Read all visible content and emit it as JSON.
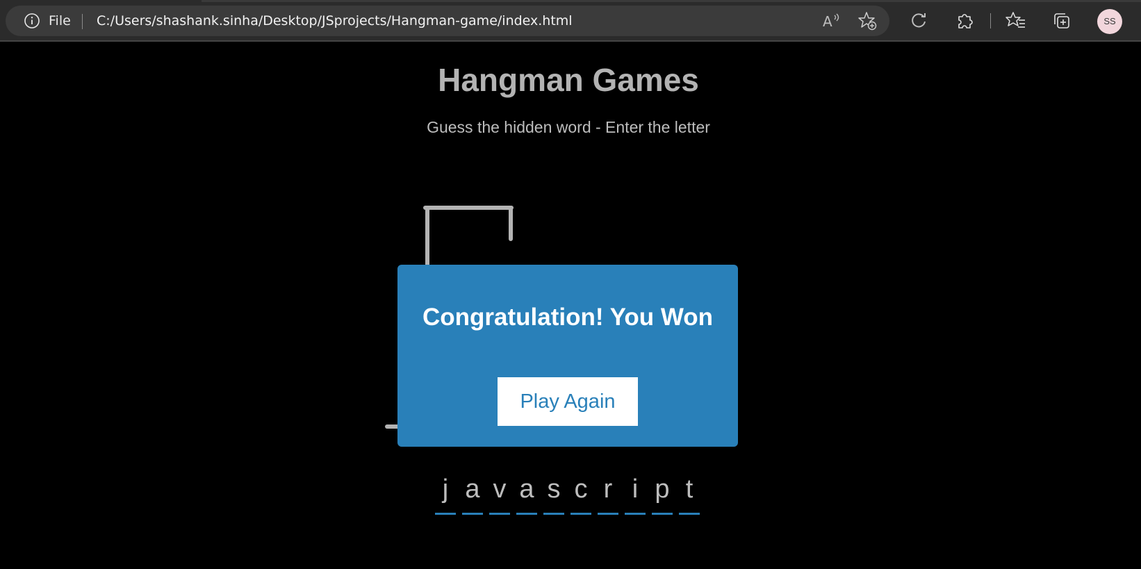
{
  "browser": {
    "info_label": "File",
    "url": "C:/Users/shashank.sinha/Desktop/JSprojects/Hangman-game/index.html",
    "profile_initials": "SS",
    "icons": [
      "info-icon",
      "read-aloud-icon",
      "add-favorite-icon",
      "refresh-icon",
      "extensions-icon",
      "favorites-icon",
      "collections-icon"
    ]
  },
  "game": {
    "title": "Hangman Games",
    "subtitle": "Guess the hidden word - Enter the letter",
    "word_letters": [
      "j",
      "a",
      "v",
      "a",
      "s",
      "c",
      "r",
      "i",
      "p",
      "t"
    ]
  },
  "popup": {
    "message": "Congratulation! You Won",
    "button_label": "Play Again"
  },
  "colors": {
    "accent": "#2980b9",
    "background": "#000000",
    "figure": "#b3b3b3"
  }
}
